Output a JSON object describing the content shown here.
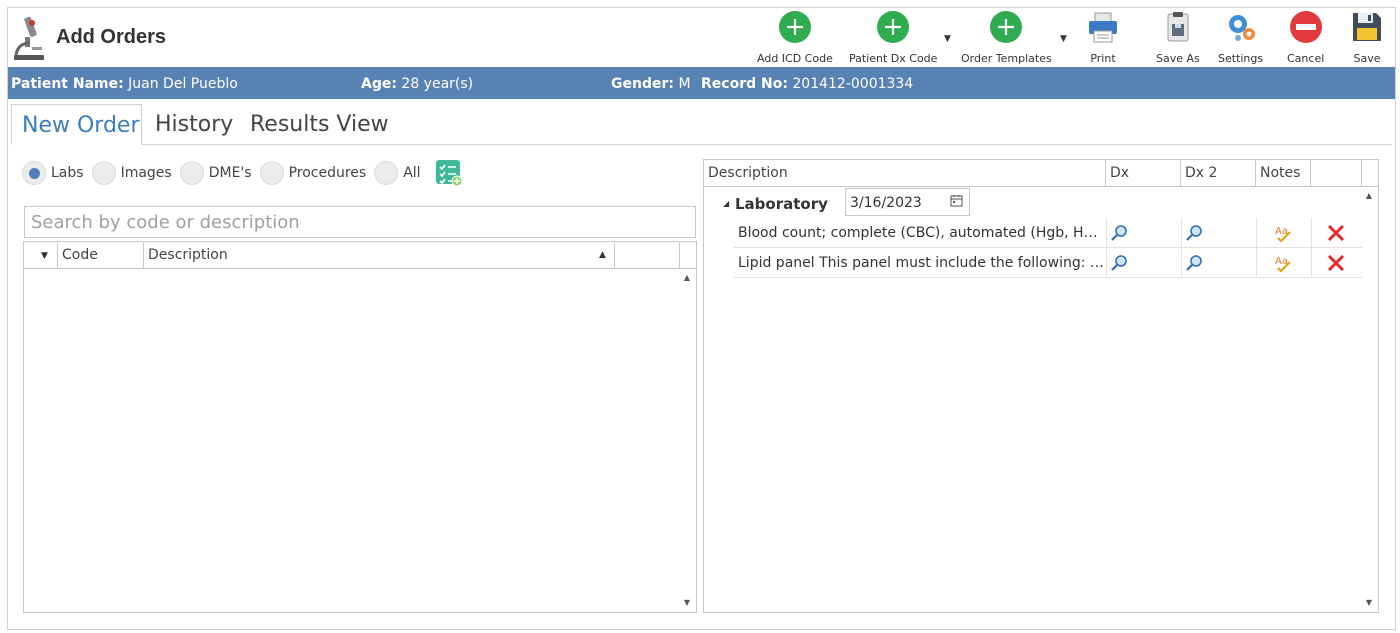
{
  "header": {
    "title": "Add Orders",
    "toolbar": [
      {
        "label": "Add ICD Code",
        "icon": "plus-circle-icon"
      },
      {
        "label": "Patient Dx Code",
        "icon": "plus-circle-icon"
      },
      {
        "label": "Order Templates",
        "icon": "plus-circle-icon"
      },
      {
        "label": "Print",
        "icon": "printer-icon"
      },
      {
        "label": "Save As",
        "icon": "clipboard-save-icon"
      },
      {
        "label": "Settings",
        "icon": "gears-icon"
      },
      {
        "label": "Cancel",
        "icon": "cancel-circle-icon"
      },
      {
        "label": "Save",
        "icon": "floppy-disk-icon"
      }
    ]
  },
  "patient": {
    "name_label": "Patient Name:",
    "name": "Juan Del Pueblo",
    "age_label": "Age:",
    "age": "28 year(s)",
    "gender_label": "Gender:",
    "gender": "M",
    "record_label": "Record No:",
    "record": "201412-0001334"
  },
  "tabs": [
    {
      "label": "New Order",
      "active": true
    },
    {
      "label": "History",
      "active": false
    },
    {
      "label": "Results View",
      "active": false
    }
  ],
  "filters": {
    "options": [
      {
        "label": "Labs",
        "selected": true
      },
      {
        "label": "Images",
        "selected": false
      },
      {
        "label": "DME's",
        "selected": false
      },
      {
        "label": "Procedures",
        "selected": false
      },
      {
        "label": "All",
        "selected": false
      }
    ]
  },
  "search": {
    "placeholder": "Search by code or description",
    "value": ""
  },
  "left_grid": {
    "columns": [
      "Code",
      "Description"
    ]
  },
  "right_grid": {
    "columns": [
      "Description",
      "Dx",
      "Dx 2",
      "Notes"
    ],
    "group": {
      "label": "Laboratory",
      "date": "3/16/2023"
    },
    "rows": [
      {
        "description": "Blood count; complete (CBC), automated (Hgb, Hct, RBC, WBC and platelet count)"
      },
      {
        "description": "Lipid panel This panel must include the following: Cholesterol, serum, total"
      }
    ]
  },
  "colors": {
    "patient_bar": "#5782b3",
    "active_tab": "#3a7ec0",
    "add_green": "#2eac4f",
    "cancel_red": "#e03a3e"
  }
}
